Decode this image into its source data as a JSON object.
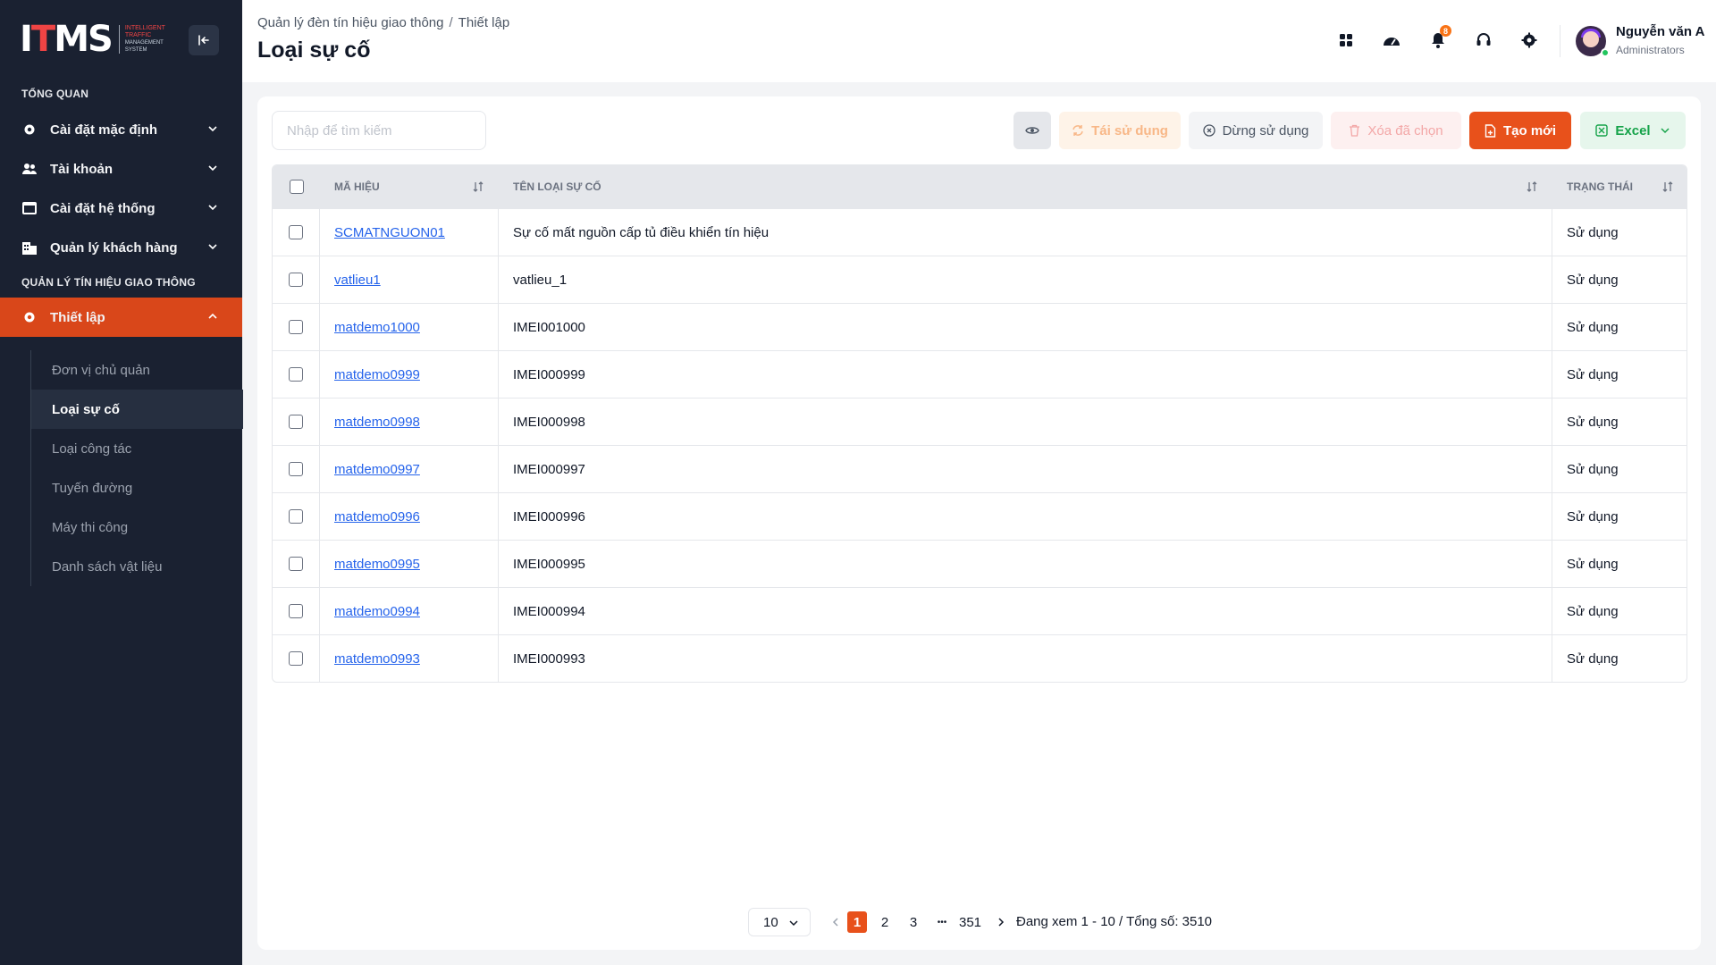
{
  "sidebar": {
    "logo": {
      "mark": "ITMS",
      "tagline_1": "INTELLIGENT",
      "tagline_2": "TRAFFIC",
      "tagline_3": "MANAGEMENT",
      "tagline_4": "SYSTEM"
    },
    "section_overview": "TỔNG QUAN",
    "items": [
      {
        "label": "Cài đặt mặc định",
        "icon": "gear-icon"
      },
      {
        "label": "Tài khoản",
        "icon": "users-icon"
      },
      {
        "label": "Cài đặt hệ thống",
        "icon": "window-icon"
      },
      {
        "label": "Quản lý khách hàng",
        "icon": "building-icon"
      }
    ],
    "section_traffic": "QUẢN LÝ TÍN HIỆU GIAO THÔNG",
    "active_group": {
      "label": "Thiết lập",
      "icon": "gear-icon"
    },
    "submenu": [
      {
        "label": "Đơn vị chủ quản"
      },
      {
        "label": "Loại sự cố",
        "active": true
      },
      {
        "label": "Loại công tác"
      },
      {
        "label": "Tuyến đường"
      },
      {
        "label": "Máy thi công"
      },
      {
        "label": "Danh sách vật liệu"
      }
    ]
  },
  "header": {
    "breadcrumb": [
      "Quản lý đèn tín hiệu giao thông",
      "Thiết lập"
    ],
    "breadcrumb_sep": "/",
    "title": "Loại sự cố",
    "notification_count": "8",
    "user": {
      "name": "Nguyễn văn A",
      "role": "Administrators"
    }
  },
  "toolbar": {
    "search_placeholder": "Nhập để tìm kiếm",
    "reuse_label": "Tái sử dụng",
    "stop_label": "Dừng sử dụng",
    "delete_label": "Xóa đã chọn",
    "create_label": "Tạo mới",
    "excel_label": "Excel"
  },
  "table": {
    "columns": {
      "code": "MÃ HIỆU",
      "name": "TÊN LOẠI SỰ CỐ",
      "status": "TRẠNG THÁI"
    },
    "rows": [
      {
        "code": "SCMATNGUON01",
        "name": "Sự cố mất nguồn cấp tủ điều khiển tín hiệu",
        "status": "Sử dụng"
      },
      {
        "code": "vatlieu1",
        "name": "vatlieu_1",
        "status": "Sử dụng"
      },
      {
        "code": "matdemo1000",
        "name": "IMEI001000",
        "status": "Sử dụng"
      },
      {
        "code": "matdemo0999",
        "name": "IMEI000999",
        "status": "Sử dụng"
      },
      {
        "code": "matdemo0998",
        "name": "IMEI000998",
        "status": "Sử dụng"
      },
      {
        "code": "matdemo0997",
        "name": "IMEI000997",
        "status": "Sử dụng"
      },
      {
        "code": "matdemo0996",
        "name": "IMEI000996",
        "status": "Sử dụng"
      },
      {
        "code": "matdemo0995",
        "name": "IMEI000995",
        "status": "Sử dụng"
      },
      {
        "code": "matdemo0994",
        "name": "IMEI000994",
        "status": "Sử dụng"
      },
      {
        "code": "matdemo0993",
        "name": "IMEI000993",
        "status": "Sử dụng"
      }
    ]
  },
  "pagination": {
    "page_size": "10",
    "pages": [
      "1",
      "2",
      "3"
    ],
    "ellipsis": "•••",
    "last_page": "351",
    "current": "1",
    "info": "Đang xem 1 - 10 / Tổng số: 3510"
  },
  "colors": {
    "accent": "#e8511b",
    "sidebar_bg": "#1a2131",
    "link": "#2563eb",
    "excel": "#16a34a"
  }
}
